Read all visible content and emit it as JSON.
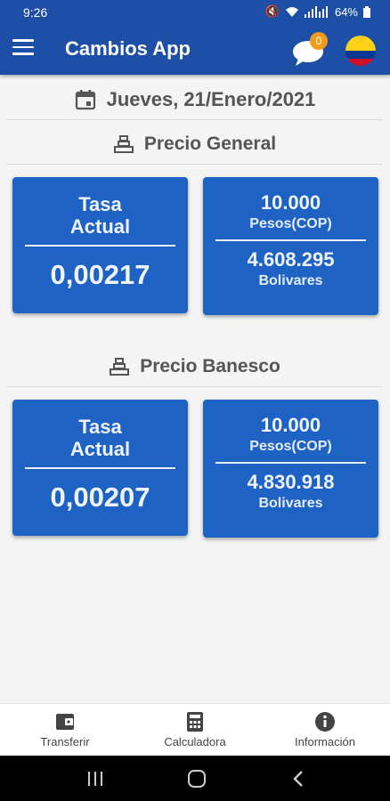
{
  "status_bar": {
    "time": "9:26",
    "battery": "64%"
  },
  "app_bar": {
    "title": "Cambios App",
    "notification_count": "0"
  },
  "date": "Jueves, 21/Enero/2021",
  "sections": [
    {
      "title": "Precio General",
      "rate_label_1": "Tasa",
      "rate_label_2": "Actual",
      "rate_value": "0,00217",
      "amount": "10.000",
      "amount_unit": "Pesos(COP)",
      "converted": "4.608.295",
      "converted_unit": "Bolivares"
    },
    {
      "title": "Precio Banesco",
      "rate_label_1": "Tasa",
      "rate_label_2": "Actual",
      "rate_value": "0,00207",
      "amount": "10.000",
      "amount_unit": "Pesos(COP)",
      "converted": "4.830.918",
      "converted_unit": "Bolivares"
    }
  ],
  "bottom_nav": [
    {
      "label": "Transferir",
      "icon": "wallet-icon"
    },
    {
      "label": "Calculadora",
      "icon": "calculator-icon"
    },
    {
      "label": "Información",
      "icon": "info-icon"
    }
  ],
  "colors": {
    "primary": "#1e4fa6",
    "card": "#1e63c4",
    "badge": "#f39a1a"
  }
}
